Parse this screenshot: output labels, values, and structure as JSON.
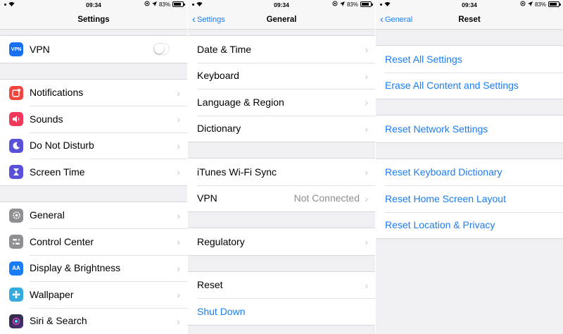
{
  "status_bar": {
    "time": "09:34",
    "battery": "83%",
    "battery_level": 0.83
  },
  "screens": [
    {
      "title": "Settings",
      "groups": [
        {
          "rows": [
            {
              "label": "VPN",
              "icon": "vpn-icon",
              "icon_text": "VPN",
              "icon_color": "#1a6ef0",
              "toggle": false
            }
          ]
        },
        {
          "rows": [
            {
              "label": "Notifications",
              "icon": "notifications-icon",
              "icon_color": "#f2453d"
            },
            {
              "label": "Sounds",
              "icon": "sounds-icon",
              "icon_color": "#f2385a"
            },
            {
              "label": "Do Not Disturb",
              "icon": "moon-icon",
              "icon_color": "#5a50d9"
            },
            {
              "label": "Screen Time",
              "icon": "hourglass-icon",
              "icon_color": "#5a50d9"
            }
          ]
        },
        {
          "rows": [
            {
              "label": "General",
              "icon": "gear-icon",
              "icon_color": "#8e8e93"
            },
            {
              "label": "Control Center",
              "icon": "control-center-icon",
              "icon_color": "#8e8e93"
            },
            {
              "label": "Display & Brightness",
              "icon": "display-icon",
              "icon_text": "AA",
              "icon_color": "#1a7cf5"
            },
            {
              "label": "Wallpaper",
              "icon": "wallpaper-icon",
              "icon_color": "#35aadc"
            },
            {
              "label": "Siri & Search",
              "icon": "siri-icon",
              "icon_color": "#2b2b3a"
            }
          ]
        }
      ]
    },
    {
      "title": "General",
      "back": "Settings",
      "groups": [
        {
          "rows": [
            {
              "label": "Date & Time"
            },
            {
              "label": "Keyboard"
            },
            {
              "label": "Language & Region"
            },
            {
              "label": "Dictionary"
            }
          ]
        },
        {
          "rows": [
            {
              "label": "iTunes Wi-Fi Sync"
            },
            {
              "label": "VPN",
              "value": "Not Connected"
            }
          ]
        },
        {
          "rows": [
            {
              "label": "Regulatory"
            }
          ]
        },
        {
          "rows": [
            {
              "label": "Reset"
            },
            {
              "label": "Shut Down",
              "blue": true,
              "no_chevron": true
            }
          ]
        }
      ]
    },
    {
      "title": "Reset",
      "back": "General",
      "groups": [
        {
          "rows": [
            {
              "label": "Reset All Settings"
            },
            {
              "label": "Erase All Content and Settings"
            }
          ]
        },
        {
          "rows": [
            {
              "label": "Reset Network Settings"
            }
          ]
        },
        {
          "rows": [
            {
              "label": "Reset Keyboard Dictionary"
            },
            {
              "label": "Reset Home Screen Layout"
            },
            {
              "label": "Reset Location & Privacy"
            }
          ]
        }
      ]
    }
  ],
  "colors": {
    "accent": "#1a7cf5",
    "chevron": "#c7c7cc",
    "background": "#efeff4"
  }
}
